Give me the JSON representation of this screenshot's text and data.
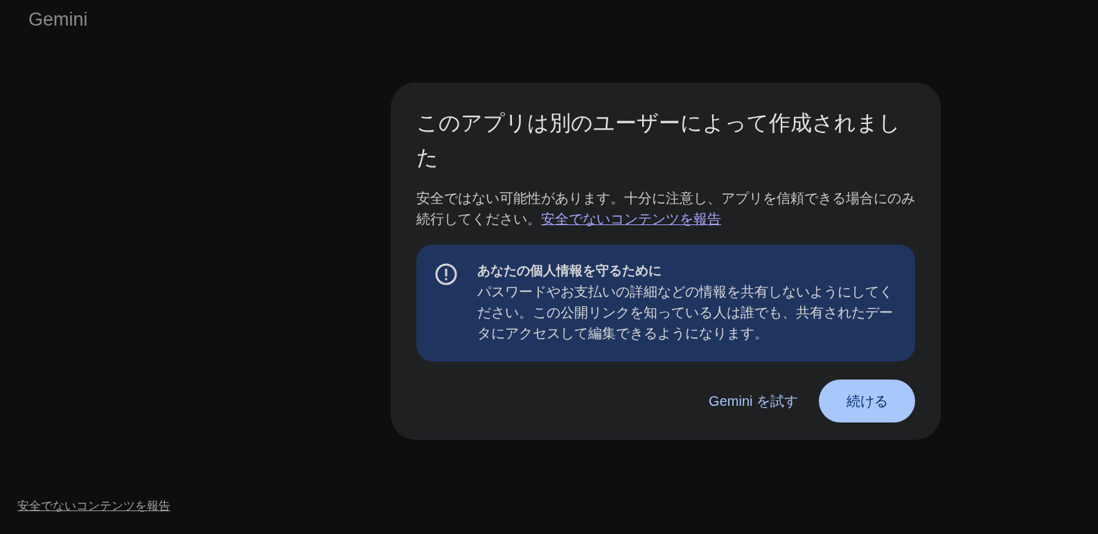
{
  "logo": {
    "text": "Gemini"
  },
  "dialog": {
    "title": "このアプリは別のユーザーによって作成されました",
    "body": "安全ではない可能性があります。十分に注意し、アプリを信頼できる場合にのみ続行してください。",
    "body_link": "安全でないコンテンツを報告",
    "notice": {
      "heading": "あなたの個人情報を守るために",
      "text": "パスワードやお支払いの詳細などの情報を共有しないようにしてください。この公開リンクを知っている人は誰でも、共有されたデータにアクセスして編集できるようになります。"
    },
    "buttons": [
      {
        "label": "Gemini を試す",
        "kind": "text"
      },
      {
        "label": "続ける",
        "kind": "filled"
      }
    ]
  },
  "footer_link": "安全でないコンテンツを報告"
}
